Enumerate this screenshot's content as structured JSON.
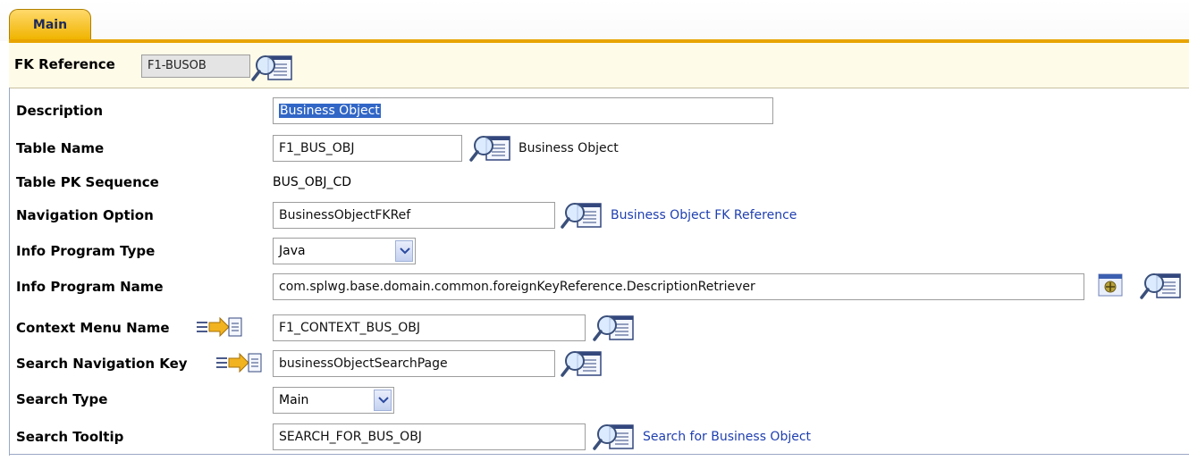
{
  "tabs": [
    {
      "label": "Main",
      "active": true
    }
  ],
  "fk_reference": {
    "label": "FK Reference",
    "value": "F1-BUSOB"
  },
  "fields": {
    "description": {
      "label": "Description",
      "value": "Business Object"
    },
    "table_name": {
      "label": "Table Name",
      "value": "F1_BUS_OBJ",
      "desc": "Business Object"
    },
    "table_pk_sequence": {
      "label": "Table PK Sequence",
      "value": "BUS_OBJ_CD"
    },
    "navigation_option": {
      "label": "Navigation Option",
      "value": "BusinessObjectFKRef",
      "desc": "Business Object FK Reference"
    },
    "info_program_type": {
      "label": "Info Program Type",
      "value": "Java"
    },
    "info_program_name": {
      "label": "Info Program Name",
      "value": "com.splwg.base.domain.common.foreignKeyReference.DescriptionRetriever"
    },
    "context_menu_name": {
      "label": "Context Menu Name",
      "value": "F1_CONTEXT_BUS_OBJ"
    },
    "search_navigation_key": {
      "label": "Search Navigation Key",
      "value": "businessObjectSearchPage"
    },
    "search_type": {
      "label": "Search Type",
      "value": "Main"
    },
    "search_tooltip": {
      "label": "Search Tooltip",
      "value": "SEARCH_FOR_BUS_OBJ",
      "desc": "Search for Business Object"
    }
  },
  "colors": {
    "tab_active": "#f0b400",
    "link": "#1f3fb0",
    "selection": "#3166c6",
    "fk_bar": "#fffbe9"
  },
  "icons": [
    "search-icon",
    "goto-icon",
    "java-source-icon"
  ]
}
